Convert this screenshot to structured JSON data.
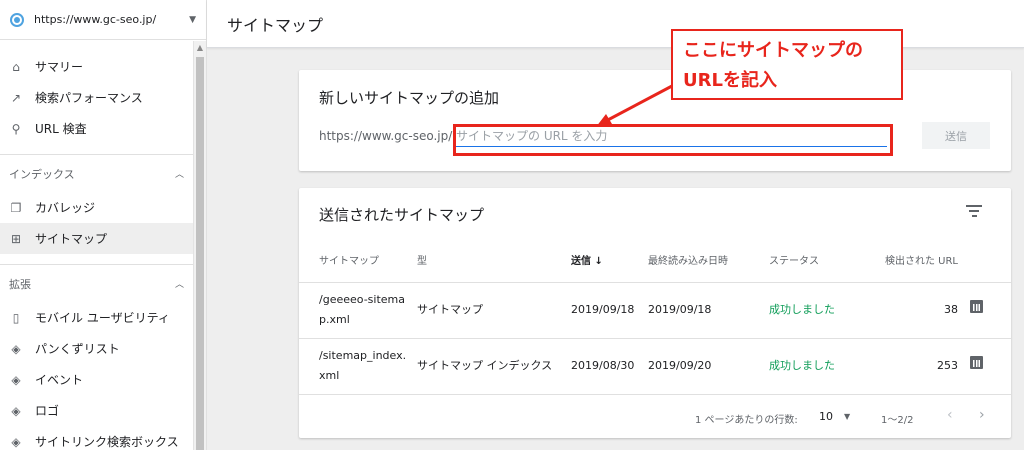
{
  "property": {
    "url": "https://www.gc-seo.jp/"
  },
  "nav": {
    "summary": "サマリー",
    "performance": "検索パフォーマンス",
    "url_inspection": "URL 検査",
    "index_group": "インデックス",
    "coverage": "カバレッジ",
    "sitemaps": "サイトマップ",
    "enhancements_group": "拡張",
    "mobile": "モバイル ユーザビリティ",
    "breadcrumbs": "パンくずリスト",
    "events": "イベント",
    "logo": "ロゴ",
    "sitelinks": "サイトリンク検索ボックス"
  },
  "header": {
    "title": "サイトマップ"
  },
  "add_card": {
    "title": "新しいサイトマップの追加",
    "prefix": "https://www.gc-seo.jp/",
    "placeholder": "サイトマップの URL を入力",
    "value": "",
    "send_label": "送信"
  },
  "table_card": {
    "title": "送信されたサイトマップ",
    "columns": {
      "sitemap": "サイトマップ",
      "type": "型",
      "submitted": "送信",
      "last_read": "最終読み込み日時",
      "status": "ステータス",
      "found_urls": "検出された URL"
    },
    "rows": [
      {
        "sitemap_l1": "/geeeeo-sitema",
        "sitemap_l2": "p.xml",
        "type": "サイトマップ",
        "submitted": "2019/09/18",
        "last_read": "2019/09/18",
        "status": "成功しました",
        "found_urls": "38"
      },
      {
        "sitemap_l1": "/sitemap_index.",
        "sitemap_l2": "xml",
        "type": "サイトマップ インデックス",
        "submitted": "2019/08/30",
        "last_read": "2019/09/20",
        "status": "成功しました",
        "found_urls": "253"
      }
    ],
    "pager": {
      "rows_label": "1 ページあたりの行数:",
      "rows_value": "10",
      "range": "1〜2/2"
    }
  },
  "annotation": {
    "line1": "ここにサイトマップの",
    "line2": "URLを記入"
  },
  "colors": {
    "accent": "#1a73e8",
    "success": "#0f9d58",
    "annotation": "#e8251c"
  }
}
